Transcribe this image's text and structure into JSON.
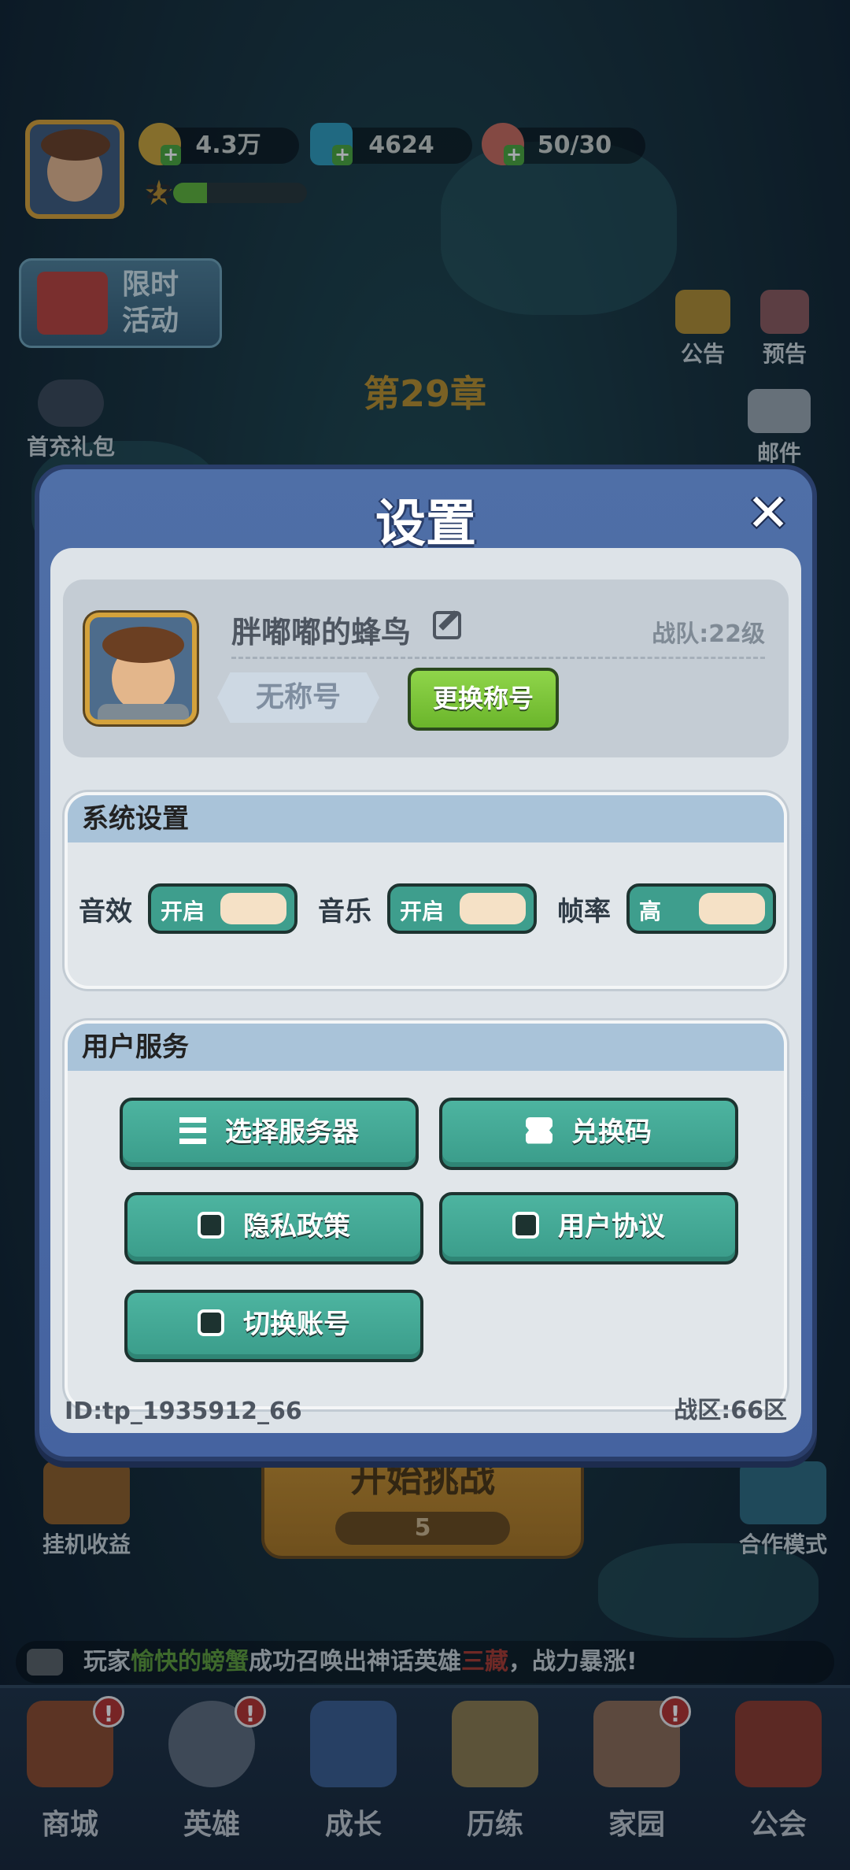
{
  "hud": {
    "gold": "4.3万",
    "gems": "4624",
    "stamina": "50/30",
    "player_level": "22",
    "level_progress": 0.25,
    "event_label_line1": "限时",
    "event_label_line2": "活动",
    "announcement_label": "公告",
    "preview_label": "预告",
    "first_recharge_label": "首充礼包",
    "mail_label": "邮件",
    "chapter": "第29章"
  },
  "dialog": {
    "title": "设置",
    "profile": {
      "nickname": "胖嘟嘟的蜂鸟",
      "team_level": "战队:22级",
      "title_tag": "无称号",
      "change_title_button": "更换称号"
    },
    "system_settings": {
      "heading": "系统设置",
      "toggles": [
        {
          "label": "音效",
          "state": "开启"
        },
        {
          "label": "音乐",
          "state": "开启"
        },
        {
          "label": "帧率",
          "state": "高"
        }
      ]
    },
    "user_service": {
      "heading": "用户服务",
      "buttons": [
        {
          "label": "选择服务器",
          "icon": "server-list-icon"
        },
        {
          "label": "兑换码",
          "icon": "ticket-icon"
        },
        {
          "label": "隐私政策",
          "icon": "document-icon"
        },
        {
          "label": "用户协议",
          "icon": "document-icon"
        },
        {
          "label": "切换账号",
          "icon": "document-icon"
        }
      ]
    },
    "footer": {
      "user_id": "ID:tp_1935912_66",
      "zone": "战区:66区"
    }
  },
  "bottom": {
    "idle_income_label": "挂机收益",
    "start_button": "开始挑战",
    "start_cost": "5",
    "coop_label": "合作模式",
    "news": {
      "prefix": "玩家",
      "player": "愉快的螃蟹",
      "middle": "成功召唤出神话英雄",
      "hero": "三藏",
      "suffix": "，战力暴涨!"
    },
    "nav": [
      {
        "label": "商城",
        "badge": "!"
      },
      {
        "label": "英雄",
        "badge": "!"
      },
      {
        "label": "成长",
        "badge": ""
      },
      {
        "label": "历练",
        "badge": ""
      },
      {
        "label": "家园",
        "badge": "!"
      },
      {
        "label": "公会",
        "badge": ""
      }
    ]
  },
  "colors": {
    "dialog_blue": "#4f6fa7",
    "teal_button": "#3e9e8d",
    "green_button": "#6bb52b",
    "section_header": "#a9c3d9"
  }
}
